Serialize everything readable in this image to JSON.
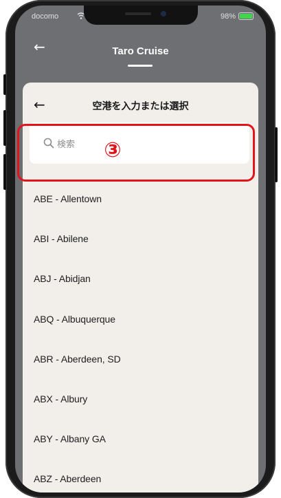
{
  "status_bar": {
    "carrier": "docomo",
    "battery_percent": "98%"
  },
  "header": {
    "back_icon": "←",
    "title": "Taro Cruise"
  },
  "sheet": {
    "back_icon": "←",
    "title": "空港を入力または選択"
  },
  "search": {
    "placeholder": "検索",
    "value": ""
  },
  "annotation": {
    "number": "③",
    "color": "#e2141b"
  },
  "airports": [
    "ABE - Allentown",
    "ABI - Abilene",
    "ABJ - Abidjan",
    "ABQ - Albuquerque",
    "ABR - Aberdeen, SD",
    "ABX - Albury",
    "ABY - Albany GA",
    "ABZ - Aberdeen"
  ],
  "colors": {
    "header_bg": "#6e6f73",
    "sheet_bg": "#f2efeb",
    "battery": "#3fd64a"
  }
}
